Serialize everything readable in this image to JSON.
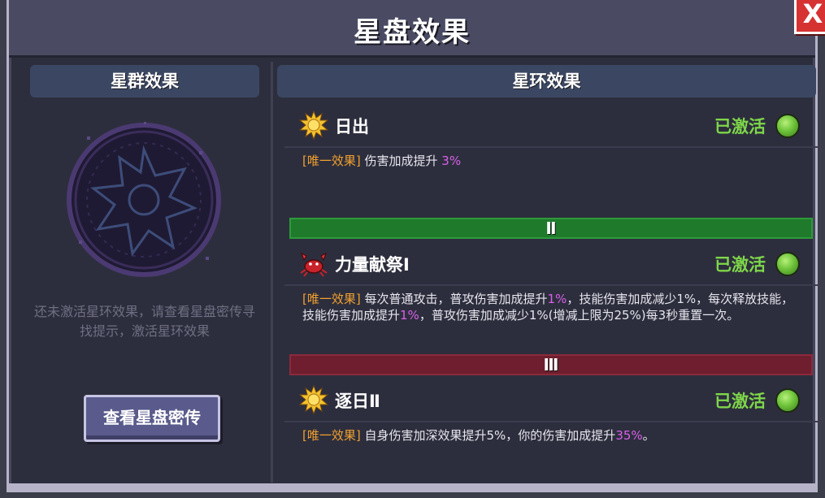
{
  "window": {
    "title": "星盘效果",
    "close_label": "X"
  },
  "left_panel": {
    "header": "星群效果",
    "hint_text": "还未激活星环效果，请查看星盘密传寻找提示，激活星环效果",
    "button_label": "查看星盘密传",
    "medallion_icon": "star-disc-icon"
  },
  "right_panel": {
    "header": "星环效果",
    "effects": [
      {
        "icon": "sun-icon",
        "name": "日出",
        "status": "已激活",
        "tag": "[唯一效果]",
        "desc_parts": [
          "伤害加成提升 ",
          "3%"
        ]
      },
      {
        "icon": "crab-icon",
        "name": "力量献祭Ⅰ",
        "status": "已激活",
        "tag": "[唯一效果]",
        "desc_parts": [
          "每次普通攻击，普攻伤害加成提升",
          "1%",
          "，技能伤害加成减少1%，每次释放技能，技能伤害加成提升",
          "1%",
          "，普攻伤害加成减少1%(增减上限为25%)每3秒重置一次。"
        ]
      },
      {
        "icon": "sun-icon",
        "name": "逐日Ⅱ",
        "status": "已激活",
        "tag": "[唯一效果]",
        "desc_parts": [
          "自身伤害加深效果提升5%，你的伤害加成提升",
          "35%",
          "。"
        ]
      }
    ],
    "tiers": [
      "Ⅱ",
      "Ⅲ"
    ]
  },
  "colors": {
    "active_green": "#7ed64a",
    "tag_orange": "#f0a030",
    "highlight_purple": "#d860e8",
    "tier2_green": "#1f7a2c",
    "tier3_red": "#6e1e2e"
  }
}
